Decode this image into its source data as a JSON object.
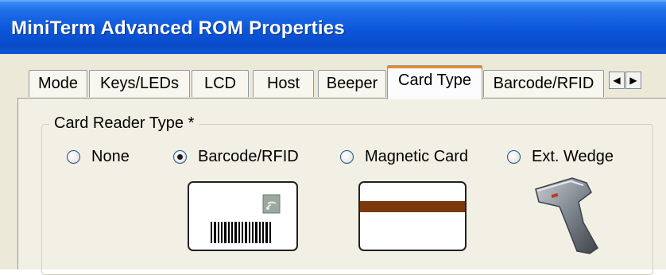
{
  "window": {
    "title": "MiniTerm Advanced ROM Properties"
  },
  "tabs": [
    {
      "label": "Mode"
    },
    {
      "label": "Keys/LEDs"
    },
    {
      "label": "LCD"
    },
    {
      "label": "Host"
    },
    {
      "label": "Beeper"
    },
    {
      "label": "Card Type"
    },
    {
      "label": "Barcode/RFID"
    }
  ],
  "active_tab": "Card Type",
  "tab_scroll": {
    "left": "◀",
    "right": "▶"
  },
  "group": {
    "label": "Card Reader Type *",
    "options": [
      {
        "label": "None",
        "checked": false
      },
      {
        "label": "Barcode/RFID",
        "checked": true
      },
      {
        "label": "Magnetic Card",
        "checked": false
      },
      {
        "label": "Ext. Wedge",
        "checked": false
      }
    ]
  },
  "colors": {
    "titlebar": "#0b55d9",
    "dialog_bg": "#ece9d8",
    "panel_bg": "#f2f0e4",
    "tab_accent": "#e68b2c",
    "magstripe": "#7a3a0c"
  }
}
